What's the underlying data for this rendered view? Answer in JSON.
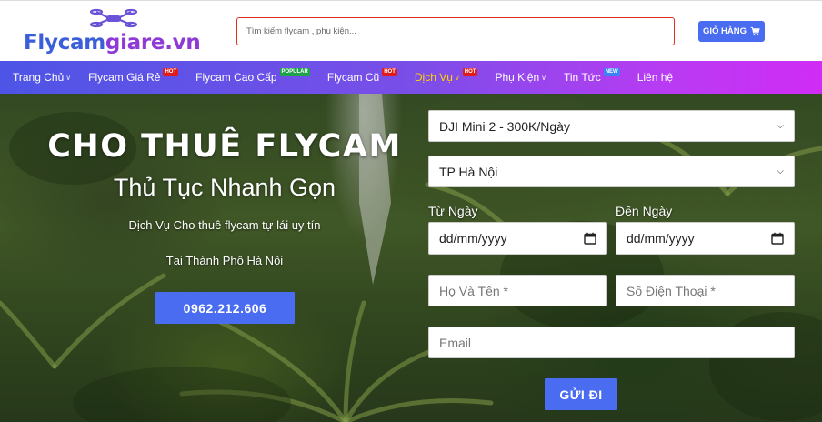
{
  "header": {
    "logo_part1": "Flycam",
    "logo_part2": "giare.vn",
    "search_placeholder": "Tìm kiếm flycam , phụ kiện...",
    "cart_label": "GIỎ HÀNG"
  },
  "nav": {
    "items": [
      {
        "label": "Trang Chủ",
        "dropdown": true,
        "badge": ""
      },
      {
        "label": "Flycam Giá Rẻ",
        "dropdown": false,
        "badge": "HOT"
      },
      {
        "label": "Flycam Cao Cấp",
        "dropdown": false,
        "badge": "POPULAR"
      },
      {
        "label": "Flycam Cũ",
        "dropdown": false,
        "badge": "HOT"
      },
      {
        "label": "Dịch Vụ",
        "dropdown": true,
        "badge": "HOT",
        "active": true
      },
      {
        "label": "Phụ Kiện",
        "dropdown": true,
        "badge": ""
      },
      {
        "label": "Tin Tức",
        "dropdown": false,
        "badge": "NEW"
      },
      {
        "label": "Liên hệ",
        "dropdown": false,
        "badge": ""
      }
    ]
  },
  "hero": {
    "title": "CHO THUÊ FLYCAM",
    "subtitle": "Thủ Tục Nhanh Gọn",
    "line1": "Dịch Vụ Cho thuê flycam tự lái uy tín",
    "line2": "Tại Thành Phố Hà Nội",
    "phone": "0962.212.606"
  },
  "form": {
    "product_value": "DJI Mini 2 - 300K/Ngày",
    "city_value": "TP Hà Nội",
    "from_label": "Từ Ngày",
    "to_label": "Đến Ngày",
    "date_placeholder": "dd/mm/yyyy",
    "name_placeholder": "Họ Và Tên *",
    "phone_placeholder": "Số Điện Thoại *",
    "email_placeholder": "Email",
    "submit_label": "GỬI ĐI"
  },
  "colors": {
    "brand_blue": "#4a6cf0",
    "logo_purple": "#8e3ad6",
    "active_nav": "#ffd700",
    "hot_badge": "#e01b1b"
  }
}
